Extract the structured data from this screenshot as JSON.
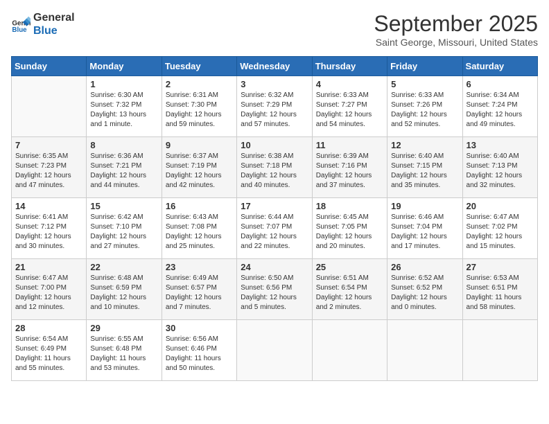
{
  "header": {
    "logo_line1": "General",
    "logo_line2": "Blue",
    "month": "September 2025",
    "location": "Saint George, Missouri, United States"
  },
  "weekdays": [
    "Sunday",
    "Monday",
    "Tuesday",
    "Wednesday",
    "Thursday",
    "Friday",
    "Saturday"
  ],
  "weeks": [
    [
      {
        "day": "",
        "info": ""
      },
      {
        "day": "1",
        "info": "Sunrise: 6:30 AM\nSunset: 7:32 PM\nDaylight: 13 hours\nand 1 minute."
      },
      {
        "day": "2",
        "info": "Sunrise: 6:31 AM\nSunset: 7:30 PM\nDaylight: 12 hours\nand 59 minutes."
      },
      {
        "day": "3",
        "info": "Sunrise: 6:32 AM\nSunset: 7:29 PM\nDaylight: 12 hours\nand 57 minutes."
      },
      {
        "day": "4",
        "info": "Sunrise: 6:33 AM\nSunset: 7:27 PM\nDaylight: 12 hours\nand 54 minutes."
      },
      {
        "day": "5",
        "info": "Sunrise: 6:33 AM\nSunset: 7:26 PM\nDaylight: 12 hours\nand 52 minutes."
      },
      {
        "day": "6",
        "info": "Sunrise: 6:34 AM\nSunset: 7:24 PM\nDaylight: 12 hours\nand 49 minutes."
      }
    ],
    [
      {
        "day": "7",
        "info": "Sunrise: 6:35 AM\nSunset: 7:23 PM\nDaylight: 12 hours\nand 47 minutes."
      },
      {
        "day": "8",
        "info": "Sunrise: 6:36 AM\nSunset: 7:21 PM\nDaylight: 12 hours\nand 44 minutes."
      },
      {
        "day": "9",
        "info": "Sunrise: 6:37 AM\nSunset: 7:19 PM\nDaylight: 12 hours\nand 42 minutes."
      },
      {
        "day": "10",
        "info": "Sunrise: 6:38 AM\nSunset: 7:18 PM\nDaylight: 12 hours\nand 40 minutes."
      },
      {
        "day": "11",
        "info": "Sunrise: 6:39 AM\nSunset: 7:16 PM\nDaylight: 12 hours\nand 37 minutes."
      },
      {
        "day": "12",
        "info": "Sunrise: 6:40 AM\nSunset: 7:15 PM\nDaylight: 12 hours\nand 35 minutes."
      },
      {
        "day": "13",
        "info": "Sunrise: 6:40 AM\nSunset: 7:13 PM\nDaylight: 12 hours\nand 32 minutes."
      }
    ],
    [
      {
        "day": "14",
        "info": "Sunrise: 6:41 AM\nSunset: 7:12 PM\nDaylight: 12 hours\nand 30 minutes."
      },
      {
        "day": "15",
        "info": "Sunrise: 6:42 AM\nSunset: 7:10 PM\nDaylight: 12 hours\nand 27 minutes."
      },
      {
        "day": "16",
        "info": "Sunrise: 6:43 AM\nSunset: 7:08 PM\nDaylight: 12 hours\nand 25 minutes."
      },
      {
        "day": "17",
        "info": "Sunrise: 6:44 AM\nSunset: 7:07 PM\nDaylight: 12 hours\nand 22 minutes."
      },
      {
        "day": "18",
        "info": "Sunrise: 6:45 AM\nSunset: 7:05 PM\nDaylight: 12 hours\nand 20 minutes."
      },
      {
        "day": "19",
        "info": "Sunrise: 6:46 AM\nSunset: 7:04 PM\nDaylight: 12 hours\nand 17 minutes."
      },
      {
        "day": "20",
        "info": "Sunrise: 6:47 AM\nSunset: 7:02 PM\nDaylight: 12 hours\nand 15 minutes."
      }
    ],
    [
      {
        "day": "21",
        "info": "Sunrise: 6:47 AM\nSunset: 7:00 PM\nDaylight: 12 hours\nand 12 minutes."
      },
      {
        "day": "22",
        "info": "Sunrise: 6:48 AM\nSunset: 6:59 PM\nDaylight: 12 hours\nand 10 minutes."
      },
      {
        "day": "23",
        "info": "Sunrise: 6:49 AM\nSunset: 6:57 PM\nDaylight: 12 hours\nand 7 minutes."
      },
      {
        "day": "24",
        "info": "Sunrise: 6:50 AM\nSunset: 6:56 PM\nDaylight: 12 hours\nand 5 minutes."
      },
      {
        "day": "25",
        "info": "Sunrise: 6:51 AM\nSunset: 6:54 PM\nDaylight: 12 hours\nand 2 minutes."
      },
      {
        "day": "26",
        "info": "Sunrise: 6:52 AM\nSunset: 6:52 PM\nDaylight: 12 hours\nand 0 minutes."
      },
      {
        "day": "27",
        "info": "Sunrise: 6:53 AM\nSunset: 6:51 PM\nDaylight: 11 hours\nand 58 minutes."
      }
    ],
    [
      {
        "day": "28",
        "info": "Sunrise: 6:54 AM\nSunset: 6:49 PM\nDaylight: 11 hours\nand 55 minutes."
      },
      {
        "day": "29",
        "info": "Sunrise: 6:55 AM\nSunset: 6:48 PM\nDaylight: 11 hours\nand 53 minutes."
      },
      {
        "day": "30",
        "info": "Sunrise: 6:56 AM\nSunset: 6:46 PM\nDaylight: 11 hours\nand 50 minutes."
      },
      {
        "day": "",
        "info": ""
      },
      {
        "day": "",
        "info": ""
      },
      {
        "day": "",
        "info": ""
      },
      {
        "day": "",
        "info": ""
      }
    ]
  ]
}
